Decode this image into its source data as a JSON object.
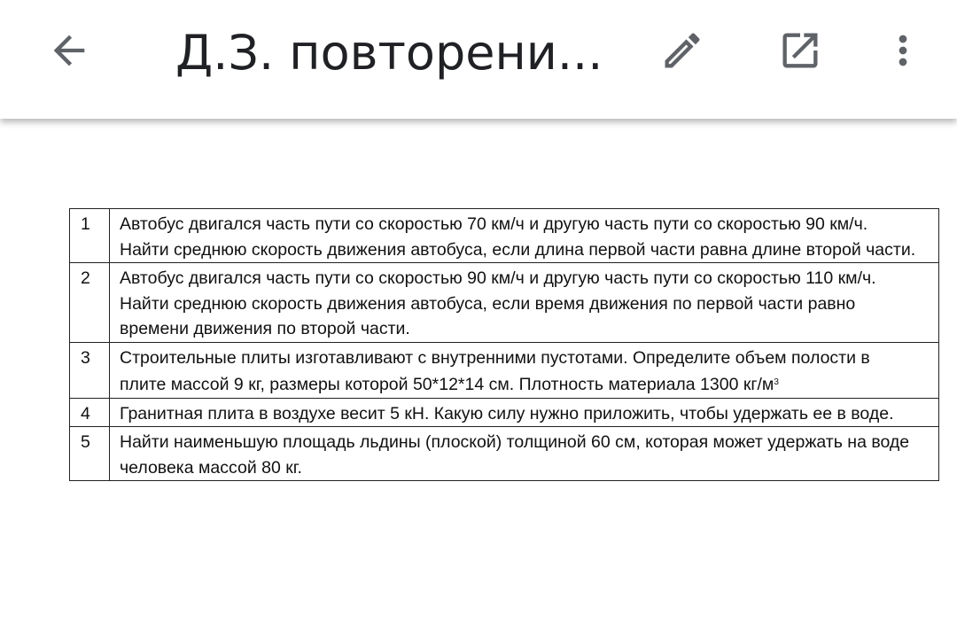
{
  "toolbar": {
    "title": "Д.З. повторени...",
    "back_icon": "arrow-back-icon",
    "edit_icon": "pencil-icon",
    "open_icon": "open-in-new-icon",
    "more_icon": "more-vert-icon",
    "icon_color": "#5f6368"
  },
  "document": {
    "rows": [
      {
        "num": "1",
        "text": "Автобус двигался   часть пути со скоростью 70 км/ч  и другую часть пути со скоростью 90 км/ч. Найти среднюю скорость движения автобуса, если длина первой части равна длине второй части."
      },
      {
        "num": "2",
        "text": "Автобус двигался   часть пути со скоростью 90 км/ч  и другую часть пути со скоростью 110 км/ч. Найти среднюю скорость движения автобуса, если время движения по первой части равно времени движения по  второй части."
      },
      {
        "num": "3",
        "text": "Строительные плиты изготавливают с внутренними пустотами. Определите объем полости в плите массой 9 кг, размеры которой 50*12*14  см. Плотность материала 1300 кг/м",
        "superscript": "3"
      },
      {
        "num": "4",
        "text": "Гранитная плита в воздухе весит 5 кН. Какую силу нужно приложить, чтобы удержать ее в воде."
      },
      {
        "num": "5",
        "text": "Найти  наименьшую площадь льдины (плоской) толщиной 60 см, которая может удержать на воде человека массой 80 кг."
      }
    ]
  }
}
